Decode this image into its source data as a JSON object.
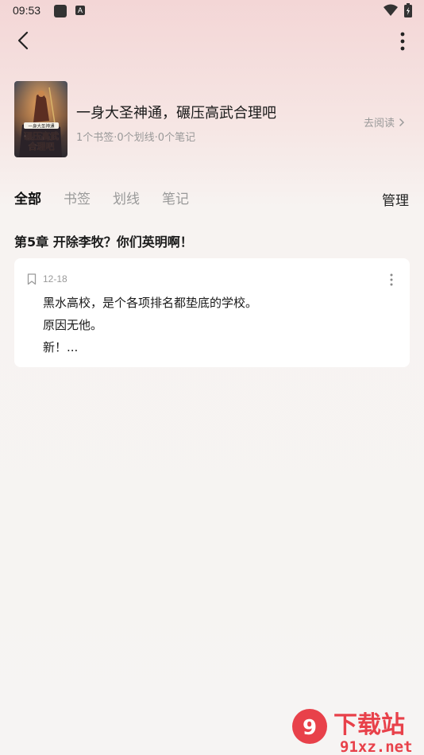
{
  "status_bar": {
    "time": "09:53",
    "notif_letter": "A"
  },
  "book": {
    "title": "一身大圣神通，碾压高武合理吧",
    "stats": "1个书签·0个划线·0个笔记",
    "go_read_label": "去阅读",
    "cover_text_line1": "一身大圣神通",
    "cover_text_line2": "碾压高武",
    "cover_text_line3": "合理吧"
  },
  "tabs": [
    {
      "label": "全部",
      "active": true
    },
    {
      "label": "书签",
      "active": false
    },
    {
      "label": "划线",
      "active": false
    },
    {
      "label": "笔记",
      "active": false
    }
  ],
  "manage_label": "管理",
  "chapter": {
    "title": "第5章 开除李牧？你们英明啊！"
  },
  "note": {
    "date": "12-18",
    "lines": [
      "黑水高校，是个各项排名都垫底的学校。",
      "原因无他。",
      "新！..."
    ]
  },
  "watermark": {
    "brand_text": "下载站",
    "domain": "91xz.net"
  },
  "colors": {
    "accent_pink": "#f3d6d6",
    "watermark_red": "#e8414a"
  }
}
